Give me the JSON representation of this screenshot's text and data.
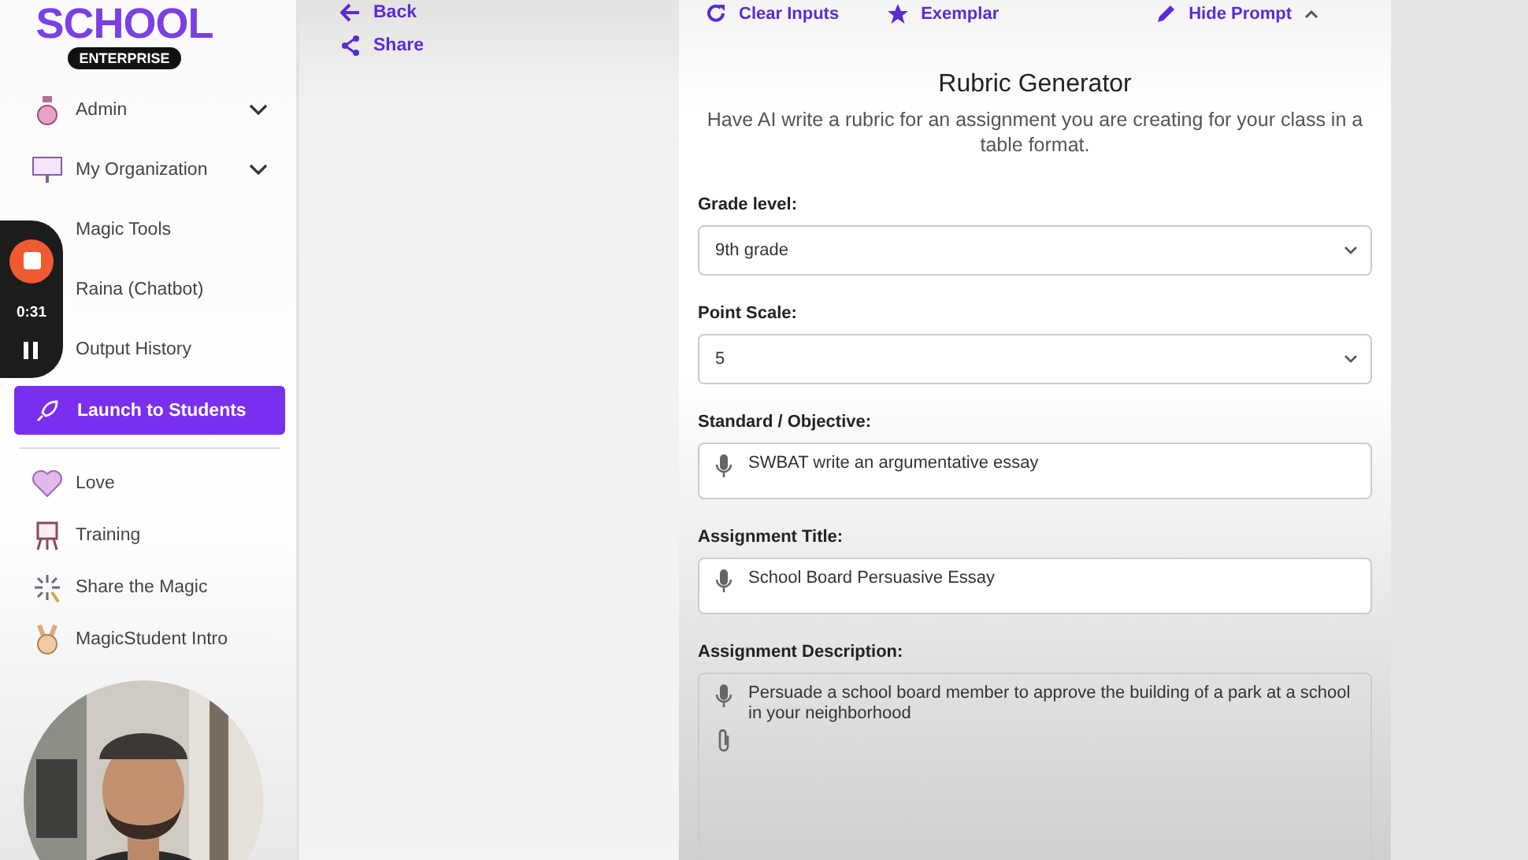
{
  "logo": {
    "word": "SCHOOL",
    "badge": "ENTERPRISE"
  },
  "sidebar": {
    "items": [
      {
        "label": "Admin",
        "expandable": true
      },
      {
        "label": "My Organization",
        "expandable": true
      },
      {
        "label": "Magic Tools",
        "expandable": false
      },
      {
        "label": "Raina (Chatbot)",
        "expandable": false
      },
      {
        "label": "Output History",
        "expandable": false
      }
    ],
    "launch_button": "Launch to Students",
    "extra_items": [
      {
        "label": "Love"
      },
      {
        "label": "Training"
      },
      {
        "label": "Share the Magic"
      },
      {
        "label": "MagicStudent Intro"
      }
    ]
  },
  "recorder": {
    "time": "0:31"
  },
  "nav": [
    {
      "label": "Back"
    },
    {
      "label": "Share"
    }
  ],
  "toolbar": [
    {
      "label": "Clear Inputs"
    },
    {
      "label": "Exemplar"
    },
    {
      "label": "Hide Prompt"
    }
  ],
  "form": {
    "title": "Rubric Generator",
    "description": "Have AI write a rubric for an assignment you are creating for your class in a table format.",
    "fields": [
      {
        "label": "Grade level:",
        "kind": "select",
        "value": "9th grade"
      },
      {
        "label": "Point Scale:",
        "kind": "select",
        "value": "5"
      },
      {
        "label": "Standard / Objective:",
        "kind": "text",
        "value": "SWBAT write an argumentative essay"
      },
      {
        "label": "Assignment Title:",
        "kind": "text",
        "value": "School Board Persuasive Essay"
      },
      {
        "label": "Assignment Description:",
        "kind": "long",
        "value": "Persuade a school board member to approve the building of a park at a school in your neighborhood"
      }
    ]
  }
}
